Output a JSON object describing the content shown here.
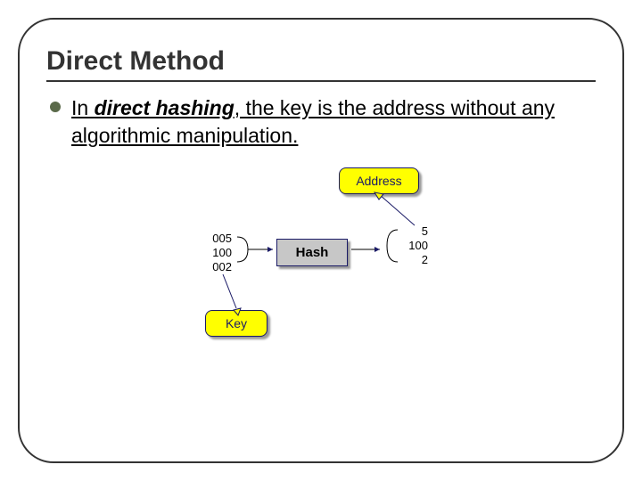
{
  "title": "Direct Method",
  "bullet": {
    "prefix": "In ",
    "emph": "direct hashing",
    "rest": ", the key is the address without any algorithmic manipulation."
  },
  "diagram": {
    "address_label": "Address",
    "key_label": "Key",
    "hash_label": "Hash",
    "inputs": [
      "005",
      "100",
      "002"
    ],
    "outputs": [
      "5",
      "100",
      "2"
    ]
  }
}
